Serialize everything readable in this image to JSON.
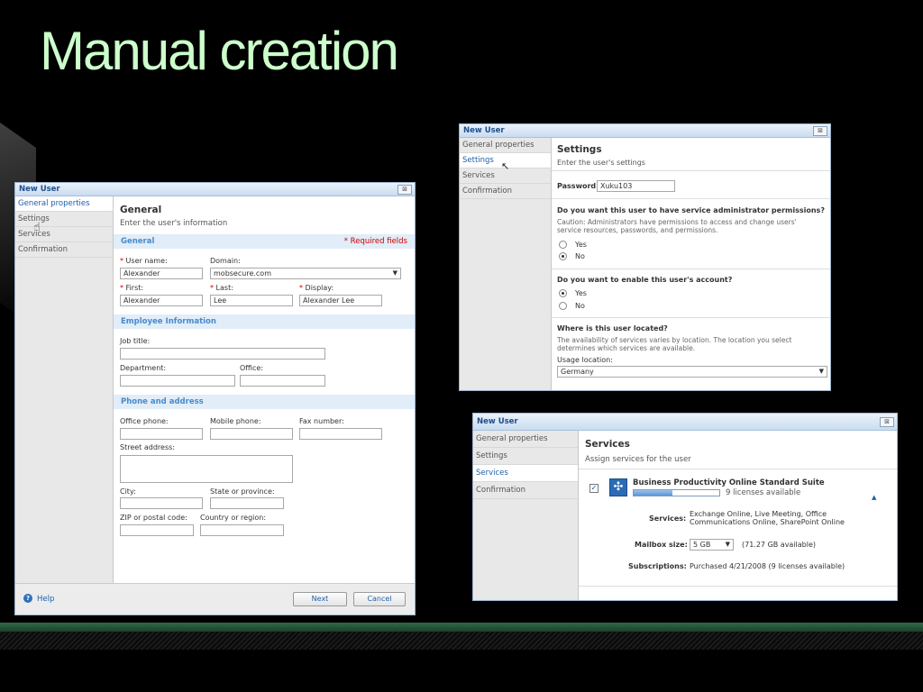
{
  "slide": {
    "title": "Manual creation"
  },
  "window_general": {
    "title": "New User",
    "close": "⊠",
    "nav": [
      "General properties",
      "Settings",
      "Services",
      "Confirmation"
    ],
    "heading": "General",
    "subheading": "Enter the user's information",
    "section_general": "General",
    "required_note": "* Required fields",
    "user_name_label": "User name:",
    "user_name_value": "Alexander",
    "domain_label": "Domain:",
    "domain_value": "mobsecure.com",
    "first_label": "First:",
    "first_value": "Alexander",
    "last_label": "Last:",
    "last_value": "Lee",
    "display_label": "Display:",
    "display_value": "Alexander Lee",
    "section_employee": "Employee Information",
    "job_title_label": "Job title:",
    "department_label": "Department:",
    "office_label": "Office:",
    "section_phone": "Phone and address",
    "office_phone_label": "Office phone:",
    "mobile_phone_label": "Mobile phone:",
    "fax_label": "Fax number:",
    "street_label": "Street address:",
    "city_label": "City:",
    "state_label": "State or province:",
    "zip_label": "ZIP or postal code:",
    "country_label": "Country or region:",
    "help": "Help",
    "next": "Next",
    "cancel": "Cancel"
  },
  "window_settings": {
    "title": "New User",
    "close": "⊠",
    "nav": [
      "General properties",
      "Settings",
      "Services",
      "Confirmation"
    ],
    "heading": "Settings",
    "subheading": "Enter the user's settings",
    "password_label": "Password:",
    "password_value": "Xuku103",
    "q_admin": "Do you want this user to have service administrator permissions?",
    "q_admin_caution": "Caution: Administrators have permissions to access and change users' service resources, passwords, and permissions.",
    "yes": "Yes",
    "no": "No",
    "q_enable": "Do you want to enable this user's account?",
    "q_location": "Where is this user located?",
    "q_location_note": "The availability of services varies by location. The location you select determines which services are available.",
    "usage_location_label": "Usage location:",
    "usage_location_value": "Germany"
  },
  "window_services": {
    "title": "New User",
    "close": "⊠",
    "nav": [
      "General properties",
      "Settings",
      "Services",
      "Confirmation"
    ],
    "heading": "Services",
    "subheading": "Assign services for the user",
    "suite_name": "Business Productivity Online Standard Suite",
    "licenses": "9 licenses available",
    "license_fill_fraction": 0.45,
    "services_label": "Services:",
    "services_value": "Exchange Online, Live Meeting, Office Communications Online, SharePoint Online",
    "mailbox_label": "Mailbox size:",
    "mailbox_value": "5 GB",
    "mailbox_available": "(71.27 GB available)",
    "subscriptions_label": "Subscriptions:",
    "subscriptions_value": "Purchased 4/21/2008 (9 licenses available)"
  },
  "colors": {
    "title_green": "#ccffcc",
    "link_blue": "#1f5fa8",
    "section_blue": "#4a8acb"
  }
}
